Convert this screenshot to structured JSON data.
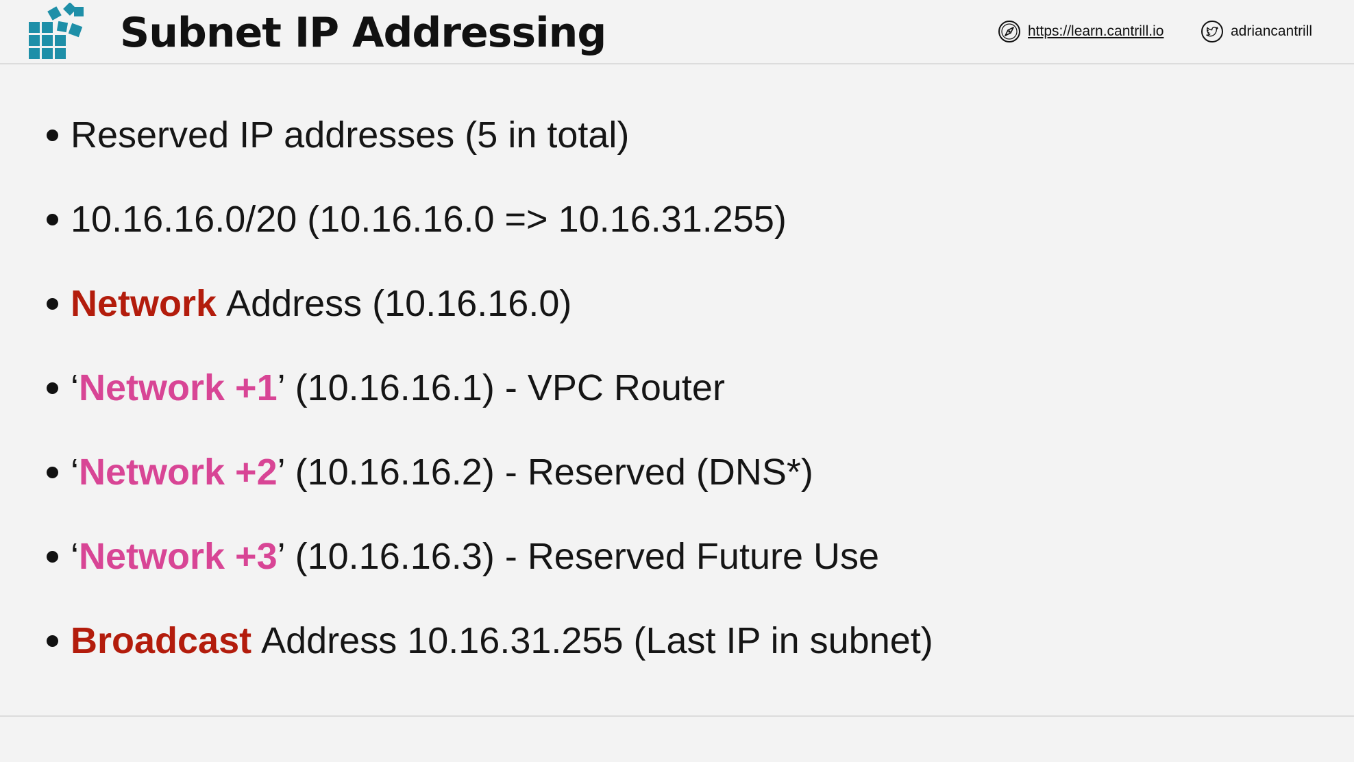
{
  "header": {
    "title": "Subnet IP Addressing",
    "website": "https://learn.cantrill.io",
    "twitter": "adriancantrill"
  },
  "colors": {
    "red_highlight": "#b31c0c",
    "pink_highlight": "#d84595",
    "logo_teal": "#1e8fa8"
  },
  "icons": {
    "logo": "blocks-logo-icon",
    "website": "compass-icon",
    "twitter": "twitter-bird-icon"
  },
  "bullets": [
    {
      "text": "Reserved IP addresses (5 in total)"
    },
    {
      "text": "10.16.16.0/20 (10.16.16.0 => 10.16.31.255)"
    },
    {
      "highlight": "Network",
      "rest": "Address (10.16.16.0)"
    },
    {
      "open_quote": "‘",
      "highlight": "Network +1",
      "close_quote": "’",
      "rest": "(10.16.16.1) - VPC Router"
    },
    {
      "open_quote": "‘",
      "highlight": "Network +2",
      "close_quote": "’",
      "rest": "(10.16.16.2) - Reserved (DNS*)"
    },
    {
      "open_quote": "‘",
      "highlight": "Network +3",
      "close_quote": "’",
      "rest": "(10.16.16.3) - Reserved Future Use"
    },
    {
      "highlight": "Broadcast",
      "rest": "Address 10.16.31.255 (Last IP in subnet)"
    }
  ]
}
